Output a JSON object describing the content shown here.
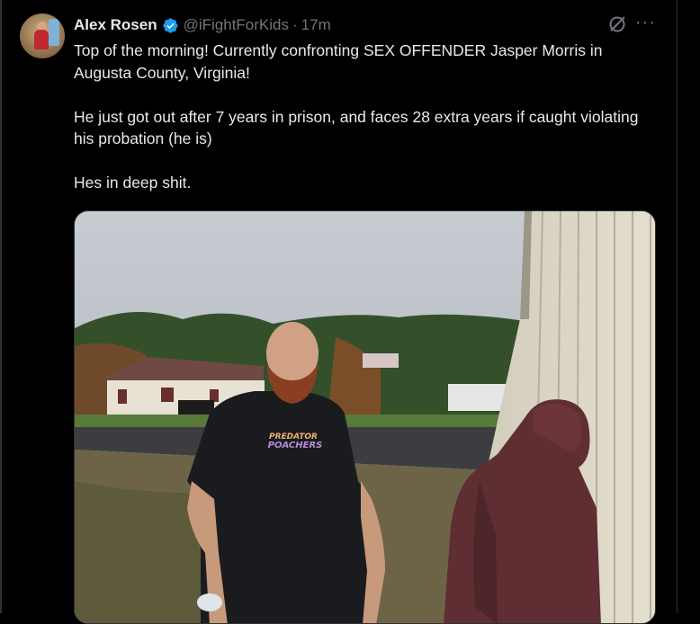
{
  "tweet": {
    "author": {
      "name": "Alex Rosen",
      "handle": "@iFightForKids",
      "verified": true
    },
    "separator": "·",
    "timestamp": "17m",
    "more_icon": "···",
    "body": [
      "Top of the morning! Currently confronting SEX OFFENDER Jasper Morris in Augusta County, Virginia!",
      "He just got out after 7 years in prison, and faces 28 extra years if caught violating his probation (he is)",
      "Hes in deep shit."
    ],
    "media": {
      "shirt_text_line1": "PREDATOR",
      "shirt_text_line2": "POACHERS"
    }
  },
  "colors": {
    "background": "#000000",
    "text": "#e7e9ea",
    "secondary_text": "#71767b",
    "verified_blue": "#1d9bf0"
  }
}
